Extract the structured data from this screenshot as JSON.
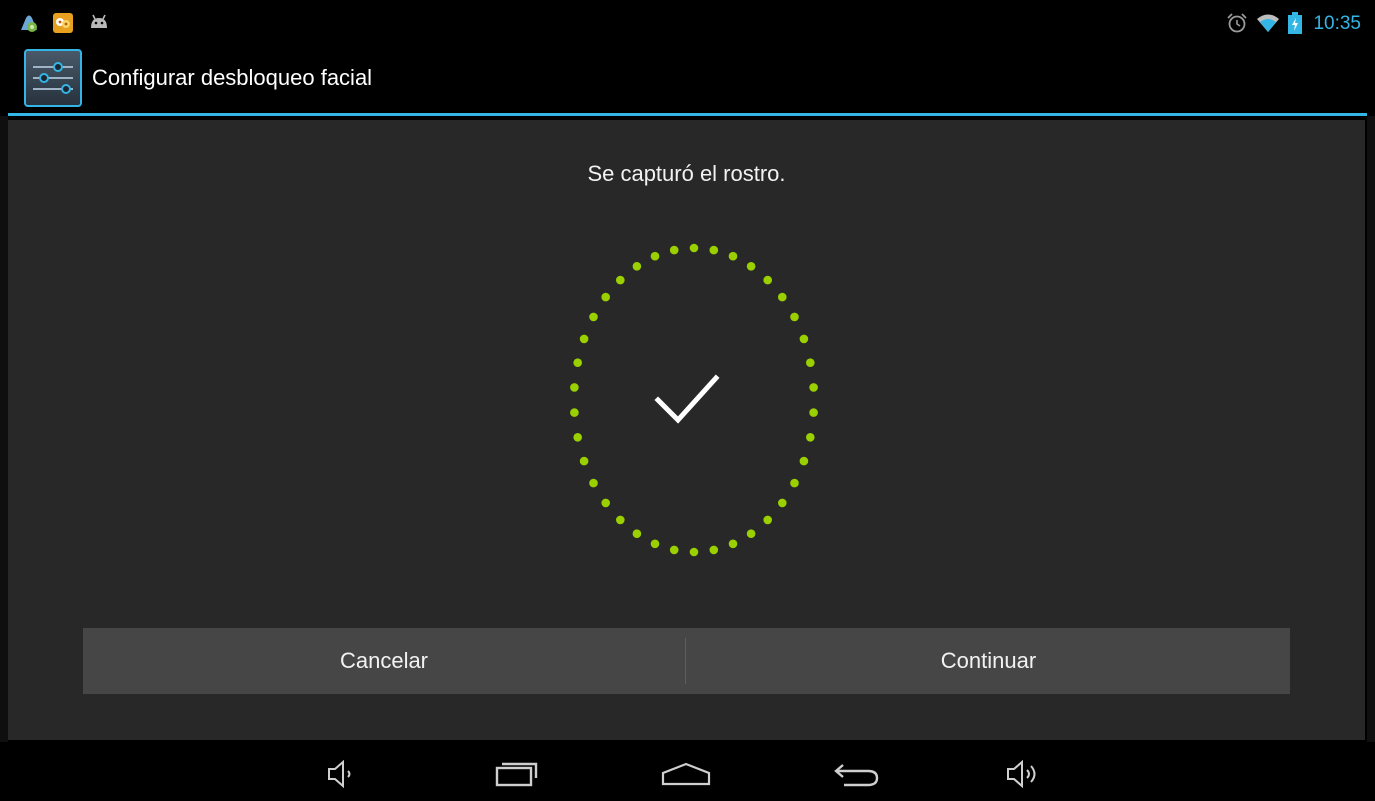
{
  "status_bar": {
    "time": "10:35",
    "notification_icons": [
      "app-notification-icon",
      "chat-app-icon",
      "android-debug-icon"
    ],
    "system_icons": [
      "alarm-icon",
      "wifi-icon",
      "battery-charging-icon"
    ],
    "accent_color": "#33b5e5"
  },
  "action_bar": {
    "title": "Configurar desbloqueo facial",
    "icon": "settings-sliders-icon"
  },
  "main": {
    "message": "Se capturó el rostro.",
    "face_ring_color": "#9bd000",
    "check_icon": "checkmark-icon"
  },
  "buttons": {
    "cancel_label": "Cancelar",
    "continue_label": "Continuar"
  },
  "nav_bar": {
    "items": [
      "volume-down-icon",
      "recent-apps-icon",
      "home-icon",
      "back-icon",
      "volume-up-icon"
    ]
  }
}
